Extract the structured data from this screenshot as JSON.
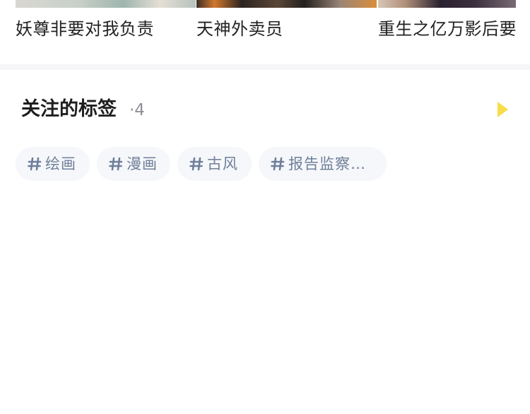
{
  "comics": [
    {
      "title": "妖尊非要对我负责"
    },
    {
      "title": "天神外卖员"
    },
    {
      "title": "重生之亿万影后要"
    }
  ],
  "followed_tags": {
    "title": "关注的标签",
    "count": "·4",
    "arrow_icon": "triangle-right-icon",
    "arrow_color": "#f7dd4a",
    "tags": [
      {
        "hash": "#",
        "label": "绘画"
      },
      {
        "hash": "#",
        "label": "漫画"
      },
      {
        "hash": "#",
        "label": "古风"
      },
      {
        "hash": "#",
        "label": "报告监察…"
      }
    ]
  },
  "colors": {
    "tag_background": "#f5f7fa",
    "tag_text": "#6f7f99",
    "title_text": "#1e1e1e",
    "count_text": "#8f8f96"
  }
}
